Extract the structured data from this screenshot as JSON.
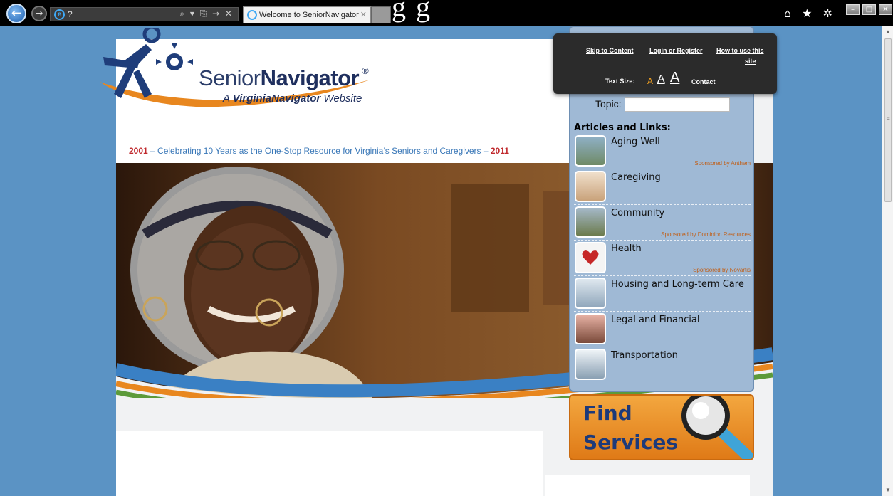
{
  "browser": {
    "address_text": "?",
    "tab_title": "Welcome to SeniorNavigator",
    "tab_close": "✕",
    "address_tools": "⌕ ▾ ⎘ → ✕",
    "ghost_title": "g   g",
    "tools_icons": "⌂ ★ ✲"
  },
  "utility": {
    "skip": "Skip to Content",
    "login": "Login or Register",
    "howto_line1": "How to use this",
    "howto_line2": "site",
    "text_size_label": "Text Size:",
    "size_small": "A",
    "size_medium": "A",
    "size_large": "A",
    "contact": "Contact"
  },
  "logo": {
    "title_part1": "Senior",
    "title_part2": "Navigator",
    "reg": "®",
    "subtitle_part1": "A ",
    "subtitle_part2": "VirginiaNavigator",
    "subtitle_part3": " Website"
  },
  "tagline": {
    "year_start": "2001",
    "text": " – Celebrating 10 Years as the One-Stop Resource for Virginia’s Seniors and Caregivers – ",
    "year_end": "2011"
  },
  "sidebar": {
    "topic_label": "Topic:",
    "topic_value": "",
    "articles_heading": "Articles and Links:",
    "articles": [
      {
        "label": "Aging Well",
        "sponsor": "Sponsored by Anthem",
        "thumb_color": "#8a9fb0"
      },
      {
        "label": "Caregiving",
        "sponsor": "",
        "thumb_color": "#d8c2a8"
      },
      {
        "label": "Community",
        "sponsor": "Sponsored by Dominion Resources",
        "thumb_color": "#7d8f6b"
      },
      {
        "label": "Health",
        "sponsor": "Sponsored by Novartis",
        "thumb_color": "#f2f2f2"
      },
      {
        "label": "Housing and Long-term Care",
        "sponsor": "",
        "thumb_color": "#9fb7cc"
      },
      {
        "label": "Legal and Financial",
        "sponsor": "",
        "thumb_color": "#b07d6a"
      },
      {
        "label": "Transportation",
        "sponsor": "",
        "thumb_color": "#d9e3ec"
      }
    ]
  },
  "find_services": {
    "line1": "Find",
    "line2": "Services"
  },
  "colors": {
    "page_bg": "#5b93c4",
    "accent_orange": "#e8871f",
    "navy": "#1f2f5e",
    "tagline_blue": "#3a78b8",
    "tagline_red": "#c0292d"
  }
}
